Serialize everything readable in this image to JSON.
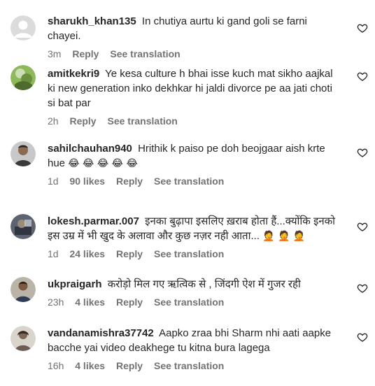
{
  "comments": [
    {
      "username": "sharukh_khan135",
      "text": "In chutiya aurtu ki gand goli se farni chayei.",
      "time": "3m",
      "likes": "",
      "reply": "Reply",
      "translate": "See translation"
    },
    {
      "username": "amitkekri9",
      "text": "Ye kesa culture h bhai isse kuch mat sikho aajkal ki new generation inko dekhkar hi jaldi divorce pe aa jati choti si bat par",
      "time": "2h",
      "likes": "",
      "reply": "Reply",
      "translate": "See translation"
    },
    {
      "username": "sahilchauhan940",
      "text": "Hrithik k paiso pe doh beojgaar aish krte hue",
      "emoji": "😂 😂 😂 😂 😂",
      "time": "1d",
      "likes": "90 likes",
      "reply": "Reply",
      "translate": "See translation"
    },
    {
      "username": "lokesh.parmar.007",
      "text": "इनका बुढ़ापा इसलिए ख़राब होता हैं...क्योंकि इनको इस उम्र में भी खुद के अलावा और कुछ नज़र नही आता...",
      "emoji": "🤦 🤦 🤦",
      "time": "1d",
      "likes": "24 likes",
      "reply": "Reply",
      "translate": "See translation"
    },
    {
      "username": "ukpraigarh",
      "text": "करोड़ो मिल गए ऋत्विक से , जिंदगी ऐश में गुजर रही",
      "time": "23h",
      "likes": "4 likes",
      "reply": "Reply",
      "translate": "See translation"
    },
    {
      "username": "vandanamishra37742",
      "text": "Aapko zraa bhi Sharm nhi aati aapke bacche yai video deakhege tu kitna bura lagega",
      "time": "16h",
      "likes": "4 likes",
      "reply": "Reply",
      "translate": "See translation"
    }
  ]
}
